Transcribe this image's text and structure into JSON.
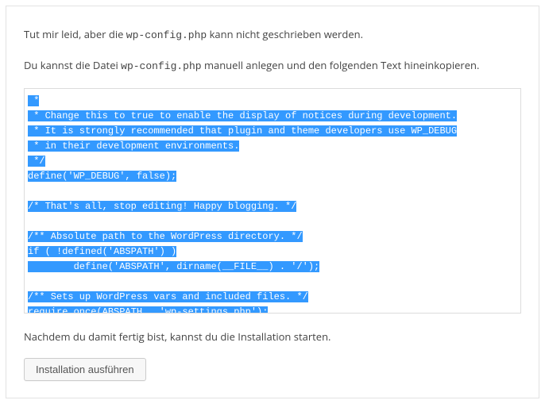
{
  "para1": {
    "pre": "Tut mir leid, aber die ",
    "code": "wp-config.php",
    "post": " kann nicht geschrieben werden."
  },
  "para2": {
    "pre": "Du kannst die Datei ",
    "code": "wp-config.php",
    "post": " manuell anlegen und den folgenden Text hineinkopieren."
  },
  "code_lines": [
    " *",
    " * Change this to true to enable the display of notices during development.",
    " * It is strongly recommended that plugin and theme developers use WP_DEBUG",
    " * in their development environments.",
    " */",
    "define('WP_DEBUG', false);",
    "",
    "/* That's all, stop editing! Happy blogging. */",
    "",
    "/** Absolute path to the WordPress directory. */",
    "if ( !defined('ABSPATH') )",
    "        define('ABSPATH', dirname(__FILE__) . '/');",
    "",
    "/** Sets up WordPress vars and included files. */",
    "require_once(ABSPATH . 'wp-settings.php');"
  ],
  "para3": "Nachdem du damit fertig bist, kannst du die Installation starten.",
  "button_label": "Installation ausführen"
}
